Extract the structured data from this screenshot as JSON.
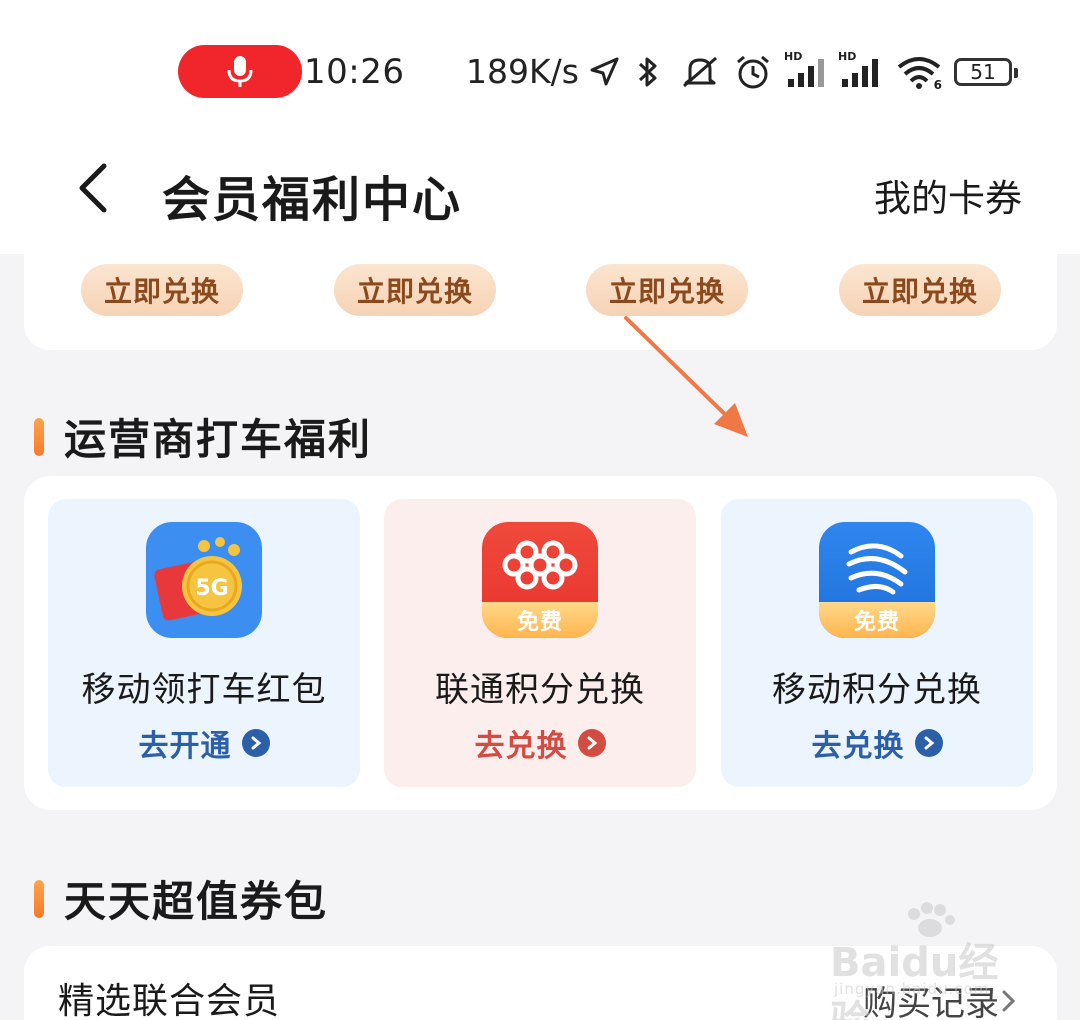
{
  "status_bar": {
    "time": "10:26",
    "network_speed": "189K/s",
    "battery_level": "51",
    "signal_label_1": "HD",
    "signal_label_2": "HD",
    "wifi_label": "6",
    "icons": [
      "mic-icon",
      "location-arrow-icon",
      "bluetooth-icon",
      "mute-icon",
      "alarm-icon",
      "signal-icon",
      "signal-icon",
      "wifi-icon",
      "battery-icon"
    ]
  },
  "header": {
    "title": "会员福利中心",
    "right_link": "我的卡券"
  },
  "top_card": {
    "buttons": [
      "立即兑换",
      "立即兑换",
      "立即兑换",
      "立即兑换"
    ]
  },
  "operator_section": {
    "title": "运营商打车福利",
    "items": [
      {
        "name": "移动领打车红包",
        "action": "去开通",
        "badge": "5G",
        "accent": "#2b5fa8",
        "bg": "#ecf4fd",
        "icon": "red-envelope-5g-icon"
      },
      {
        "name": "联通积分兑换",
        "action": "去兑换",
        "badge": "免费",
        "accent": "#d24c41",
        "bg": "#fdeeee",
        "icon": "china-unicom-icon"
      },
      {
        "name": "移动积分兑换",
        "action": "去兑换",
        "badge": "免费",
        "accent": "#2b5fa8",
        "bg": "#ecf4fd",
        "icon": "china-mobile-icon"
      }
    ]
  },
  "coupon_section": {
    "title": "天天超值券包",
    "card_title": "精选联合会员",
    "card_link": "购买记录"
  },
  "watermark": {
    "text": "Bai",
    "text2": "经验",
    "sub": "jingyan.baidu.com"
  },
  "colors": {
    "section_accent": "#f57a2a",
    "redeem_text": "#8a4a1d",
    "annotation_arrow": "#f07845"
  }
}
